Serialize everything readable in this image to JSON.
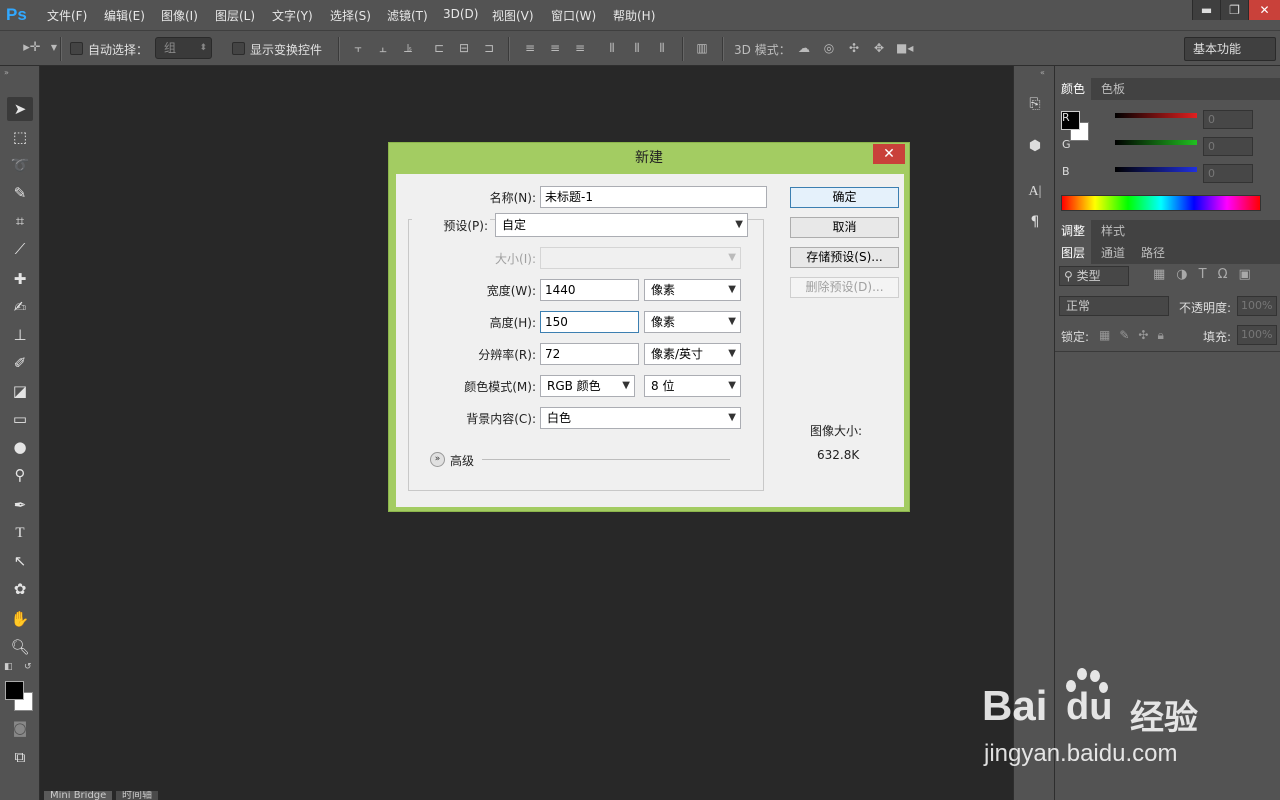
{
  "app": {
    "logo": "Ps"
  },
  "menu": [
    "文件(F)",
    "编辑(E)",
    "图像(I)",
    "图层(L)",
    "文字(Y)",
    "选择(S)",
    "滤镜(T)",
    "3D(D)",
    "视图(V)",
    "窗口(W)",
    "帮助(H)"
  ],
  "window_controls": {
    "minimize": "▬",
    "restore": "❐",
    "close": "✕"
  },
  "options": {
    "auto_select": "自动选择：",
    "group_value": "组",
    "show_transform": "显示变换控件",
    "mode3d": "3D 模式：",
    "workspace": "基本功能"
  },
  "dialog": {
    "title": "新建",
    "close": "✕",
    "name_label": "名称(N):",
    "name_value": "未标题-1",
    "preset_label": "预设(P):",
    "preset_value": "自定",
    "size_label": "大小(I):",
    "width_label": "宽度(W):",
    "width_value": "1440",
    "width_unit": "像素",
    "height_label": "高度(H):",
    "height_value": "150",
    "height_unit": "像素",
    "resolution_label": "分辨率(R):",
    "resolution_value": "72",
    "resolution_unit": "像素/英寸",
    "colormode_label": "颜色模式(M):",
    "colormode_value": "RGB 颜色",
    "bitdepth_value": "8 位",
    "background_label": "背景内容(C):",
    "background_value": "白色",
    "advanced": "高级",
    "buttons": {
      "ok": "确定",
      "cancel": "取消",
      "save_preset": "存储预设(S)...",
      "delete_preset": "删除预设(D)..."
    },
    "image_size_label": "图像大小:",
    "image_size_value": "632.8K"
  },
  "panels": {
    "color_tabs": [
      "颜色",
      "色板"
    ],
    "channels": [
      {
        "label": "R",
        "value": "0",
        "color": "#e02020"
      },
      {
        "label": "G",
        "value": "0",
        "color": "#20c020"
      },
      {
        "label": "B",
        "value": "0",
        "color": "#2030e0"
      }
    ],
    "adjust_tabs": [
      "调整",
      "样式"
    ],
    "layer_tabs": [
      "图层",
      "通道",
      "路径"
    ],
    "kind": "类型",
    "blend_mode": "正常",
    "opacity_label": "不透明度:",
    "opacity_value": "100%",
    "lock_label": "锁定:",
    "fill_label": "填充:",
    "fill_value": "100%"
  },
  "bottom_tabs": [
    "Mini Bridge",
    "时间轴"
  ],
  "watermark": {
    "brand": "Bai",
    "brand2": "du",
    "suffix": "经验",
    "url": "jingyan.baidu.com"
  }
}
